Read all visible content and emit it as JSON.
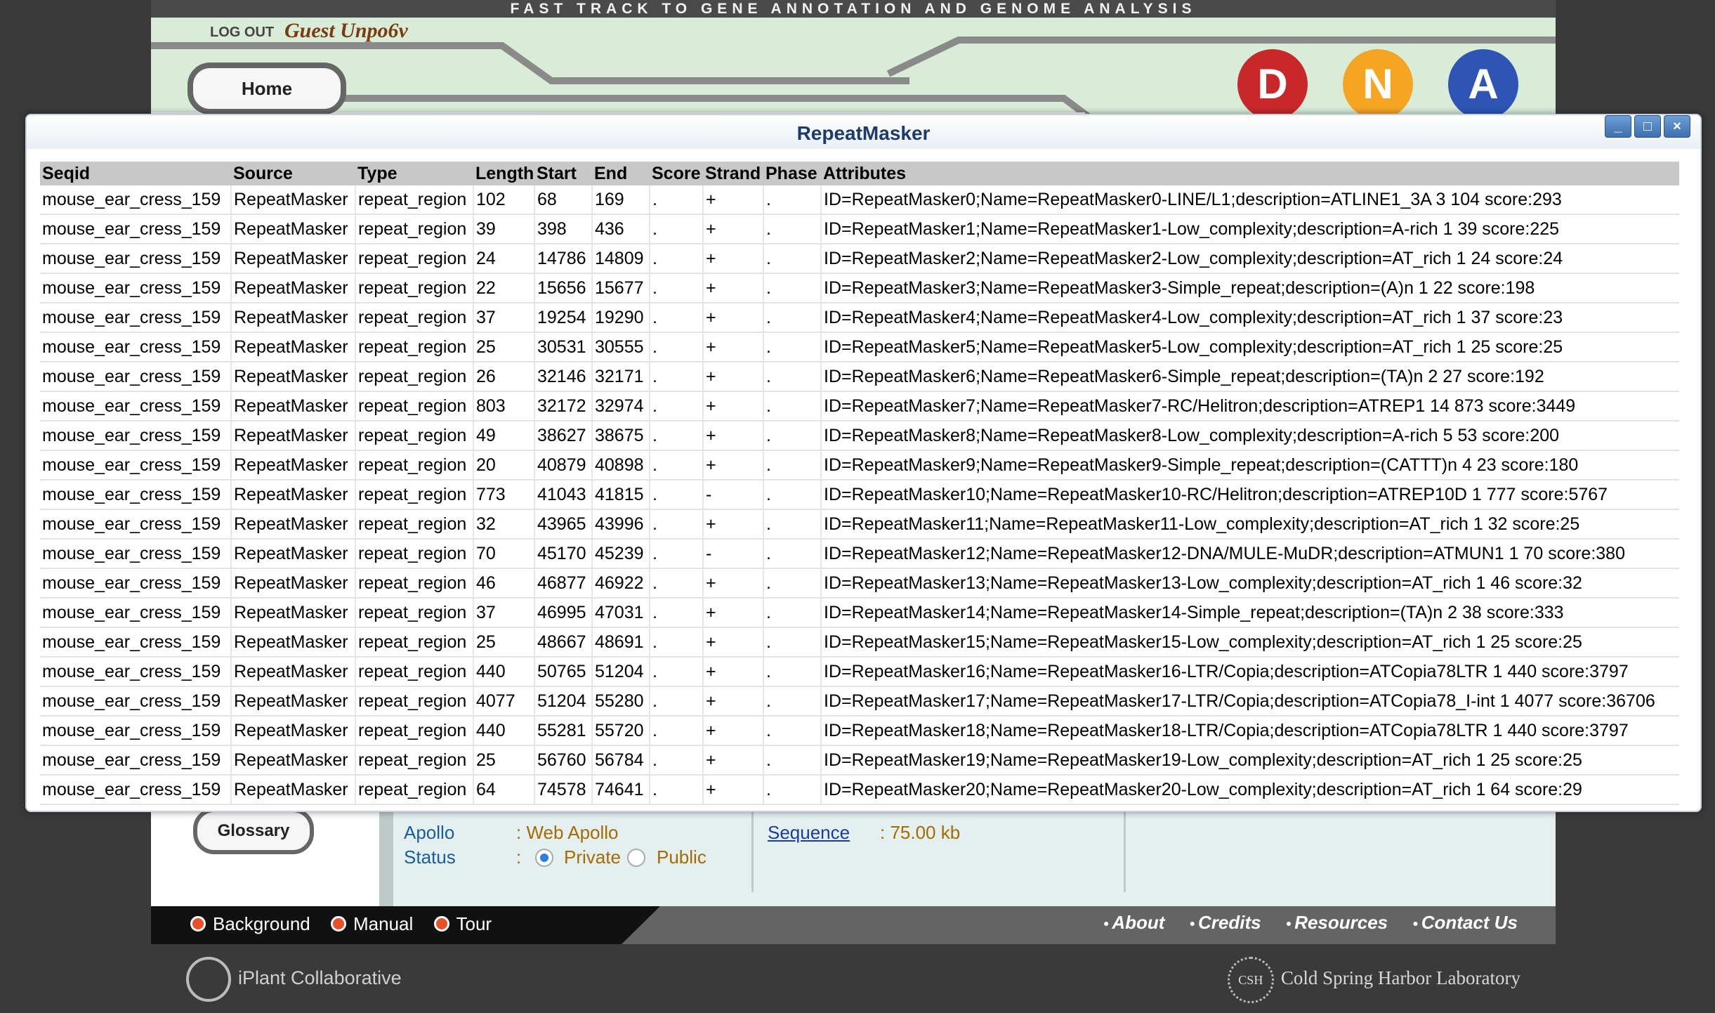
{
  "site": {
    "banner": "FAST TRACK TO GENE ANNOTATION AND GENOME ANALYSIS",
    "logout_label": "LOG OUT",
    "guest_name": "Guest Unpo6v",
    "home_label": "Home",
    "dna_letters": [
      "D",
      "N",
      "A"
    ],
    "dna_colors": [
      "#c8282a",
      "#f5a524",
      "#2e55b6"
    ],
    "glossary_label": "Glossary",
    "info": {
      "apollo_label": "Apollo",
      "apollo_value": ": Web Apollo",
      "status_label": "Status",
      "status_colon": ":",
      "status_private": "Private",
      "status_public": "Public",
      "sequence_label": "Sequence",
      "sequence_value": ": 75.00 kb"
    },
    "footer_tabs": [
      "Background",
      "Manual",
      "Tour"
    ],
    "footer_links": [
      "About",
      "Credits",
      "Resources",
      "Contact Us"
    ],
    "logo_left": "iPlant Collaborative",
    "logo_right": "Cold Spring Harbor Laboratory",
    "logo_right_mark": "CSH"
  },
  "modal": {
    "title": "RepeatMasker",
    "buttons": {
      "minimize": "_",
      "maximize": "□",
      "close": "×"
    },
    "columns": [
      "Seqid",
      "Source",
      "Type",
      "Length",
      "Start",
      "End",
      "Score",
      "Strand",
      "Phase",
      "Attributes"
    ],
    "rows": [
      [
        "mouse_ear_cress_159",
        "RepeatMasker",
        "repeat_region",
        "102",
        "68",
        "169",
        ".",
        "+",
        ".",
        "ID=RepeatMasker0;Name=RepeatMasker0-LINE/L1;description=ATLINE1_3A 3 104 score:293"
      ],
      [
        "mouse_ear_cress_159",
        "RepeatMasker",
        "repeat_region",
        "39",
        "398",
        "436",
        ".",
        "+",
        ".",
        "ID=RepeatMasker1;Name=RepeatMasker1-Low_complexity;description=A-rich 1 39 score:225"
      ],
      [
        "mouse_ear_cress_159",
        "RepeatMasker",
        "repeat_region",
        "24",
        "14786",
        "14809",
        ".",
        "+",
        ".",
        "ID=RepeatMasker2;Name=RepeatMasker2-Low_complexity;description=AT_rich 1 24 score:24"
      ],
      [
        "mouse_ear_cress_159",
        "RepeatMasker",
        "repeat_region",
        "22",
        "15656",
        "15677",
        ".",
        "+",
        ".",
        "ID=RepeatMasker3;Name=RepeatMasker3-Simple_repeat;description=(A)n 1 22 score:198"
      ],
      [
        "mouse_ear_cress_159",
        "RepeatMasker",
        "repeat_region",
        "37",
        "19254",
        "19290",
        ".",
        "+",
        ".",
        "ID=RepeatMasker4;Name=RepeatMasker4-Low_complexity;description=AT_rich 1 37 score:23"
      ],
      [
        "mouse_ear_cress_159",
        "RepeatMasker",
        "repeat_region",
        "25",
        "30531",
        "30555",
        ".",
        "+",
        ".",
        "ID=RepeatMasker5;Name=RepeatMasker5-Low_complexity;description=AT_rich 1 25 score:25"
      ],
      [
        "mouse_ear_cress_159",
        "RepeatMasker",
        "repeat_region",
        "26",
        "32146",
        "32171",
        ".",
        "+",
        ".",
        "ID=RepeatMasker6;Name=RepeatMasker6-Simple_repeat;description=(TA)n 2 27 score:192"
      ],
      [
        "mouse_ear_cress_159",
        "RepeatMasker",
        "repeat_region",
        "803",
        "32172",
        "32974",
        ".",
        "+",
        ".",
        "ID=RepeatMasker7;Name=RepeatMasker7-RC/Helitron;description=ATREP1 14 873 score:3449"
      ],
      [
        "mouse_ear_cress_159",
        "RepeatMasker",
        "repeat_region",
        "49",
        "38627",
        "38675",
        ".",
        "+",
        ".",
        "ID=RepeatMasker8;Name=RepeatMasker8-Low_complexity;description=A-rich 5 53 score:200"
      ],
      [
        "mouse_ear_cress_159",
        "RepeatMasker",
        "repeat_region",
        "20",
        "40879",
        "40898",
        ".",
        "+",
        ".",
        "ID=RepeatMasker9;Name=RepeatMasker9-Simple_repeat;description=(CATTT)n 4 23 score:180"
      ],
      [
        "mouse_ear_cress_159",
        "RepeatMasker",
        "repeat_region",
        "773",
        "41043",
        "41815",
        ".",
        "-",
        ".",
        "ID=RepeatMasker10;Name=RepeatMasker10-RC/Helitron;description=ATREP10D 1 777 score:5767"
      ],
      [
        "mouse_ear_cress_159",
        "RepeatMasker",
        "repeat_region",
        "32",
        "43965",
        "43996",
        ".",
        "+",
        ".",
        "ID=RepeatMasker11;Name=RepeatMasker11-Low_complexity;description=AT_rich 1 32 score:25"
      ],
      [
        "mouse_ear_cress_159",
        "RepeatMasker",
        "repeat_region",
        "70",
        "45170",
        "45239",
        ".",
        "-",
        ".",
        "ID=RepeatMasker12;Name=RepeatMasker12-DNA/MULE-MuDR;description=ATMUN1 1 70 score:380"
      ],
      [
        "mouse_ear_cress_159",
        "RepeatMasker",
        "repeat_region",
        "46",
        "46877",
        "46922",
        ".",
        "+",
        ".",
        "ID=RepeatMasker13;Name=RepeatMasker13-Low_complexity;description=AT_rich 1 46 score:32"
      ],
      [
        "mouse_ear_cress_159",
        "RepeatMasker",
        "repeat_region",
        "37",
        "46995",
        "47031",
        ".",
        "+",
        ".",
        "ID=RepeatMasker14;Name=RepeatMasker14-Simple_repeat;description=(TA)n 2 38 score:333"
      ],
      [
        "mouse_ear_cress_159",
        "RepeatMasker",
        "repeat_region",
        "25",
        "48667",
        "48691",
        ".",
        "+",
        ".",
        "ID=RepeatMasker15;Name=RepeatMasker15-Low_complexity;description=AT_rich 1 25 score:25"
      ],
      [
        "mouse_ear_cress_159",
        "RepeatMasker",
        "repeat_region",
        "440",
        "50765",
        "51204",
        ".",
        "+",
        ".",
        "ID=RepeatMasker16;Name=RepeatMasker16-LTR/Copia;description=ATCopia78LTR 1 440 score:3797"
      ],
      [
        "mouse_ear_cress_159",
        "RepeatMasker",
        "repeat_region",
        "4077",
        "51204",
        "55280",
        ".",
        "+",
        ".",
        "ID=RepeatMasker17;Name=RepeatMasker17-LTR/Copia;description=ATCopia78_I-int 1 4077 score:36706"
      ],
      [
        "mouse_ear_cress_159",
        "RepeatMasker",
        "repeat_region",
        "440",
        "55281",
        "55720",
        ".",
        "+",
        ".",
        "ID=RepeatMasker18;Name=RepeatMasker18-LTR/Copia;description=ATCopia78LTR 1 440 score:3797"
      ],
      [
        "mouse_ear_cress_159",
        "RepeatMasker",
        "repeat_region",
        "25",
        "56760",
        "56784",
        ".",
        "+",
        ".",
        "ID=RepeatMasker19;Name=RepeatMasker19-Low_complexity;description=AT_rich 1 25 score:25"
      ],
      [
        "mouse_ear_cress_159",
        "RepeatMasker",
        "repeat_region",
        "64",
        "74578",
        "74641",
        ".",
        "+",
        ".",
        "ID=RepeatMasker20;Name=RepeatMasker20-Low_complexity;description=AT_rich 1 64 score:29"
      ]
    ]
  }
}
